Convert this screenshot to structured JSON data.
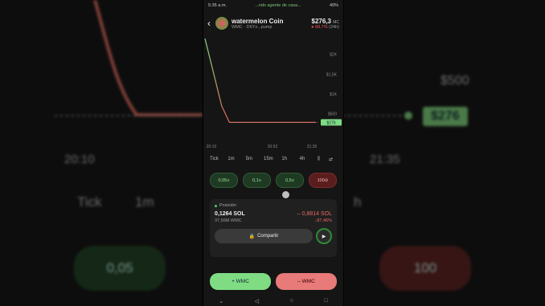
{
  "background": {
    "time_left": "20:10",
    "time_right": "21:35",
    "price_tag": "$276",
    "axis_label": "$500",
    "tf_tick": "Tick",
    "tf_1m": "1m",
    "tf_h": "h",
    "amt_left": "0,05",
    "amt_right": "100"
  },
  "status": {
    "time": "5:35 a.m.",
    "ticker": "...ndo agente de casa...",
    "battery": "49%"
  },
  "header": {
    "coin_name": "watermelon Coin",
    "coin_sub": "WMC · D6Yx...pump",
    "market_cap": "$276,3",
    "market_cap_suffix": "MC",
    "change_pct": "88,7%",
    "change_period": "(24h)"
  },
  "chart": {
    "y_ticks": [
      "$2K",
      "$1,5K",
      "$1K",
      "$500"
    ],
    "x_ticks": [
      "20:10",
      "20:52",
      "21:35"
    ],
    "price_label": "$276"
  },
  "chart_data": {
    "type": "line",
    "x": [
      "20:10",
      "20:52",
      "21:35"
    ],
    "y_ticks": [
      500,
      1000,
      1500,
      2000
    ],
    "series": [
      {
        "values_note": "",
        "points": [
          [
            0,
            2400
          ],
          [
            0.08,
            1500
          ],
          [
            0.15,
            700
          ],
          [
            0.22,
            276
          ],
          [
            1.0,
            276
          ]
        ]
      }
    ],
    "current_price": 276
  },
  "timeframes": [
    "Tick",
    "1m",
    "5m",
    "15m",
    "1h",
    "4h"
  ],
  "amounts": [
    {
      "label": "0,05",
      "side": "buy"
    },
    {
      "label": "0,1",
      "side": "buy"
    },
    {
      "label": "0,5",
      "side": "buy"
    },
    {
      "label": "100",
      "side": "sell"
    }
  ],
  "position": {
    "title": "Posición",
    "sol": "0,1264 SOL",
    "pnl": "– 0,8814 SOL",
    "tokens": "37,56M WMC",
    "pnl_pct": "↓87,46%",
    "share_label": "Compartir"
  },
  "trade": {
    "buy_label": "+ WMC",
    "sell_label": "– WMC"
  },
  "colors": {
    "buy": "#7fdc83",
    "sell": "#e87a7a",
    "background": "#151515"
  }
}
